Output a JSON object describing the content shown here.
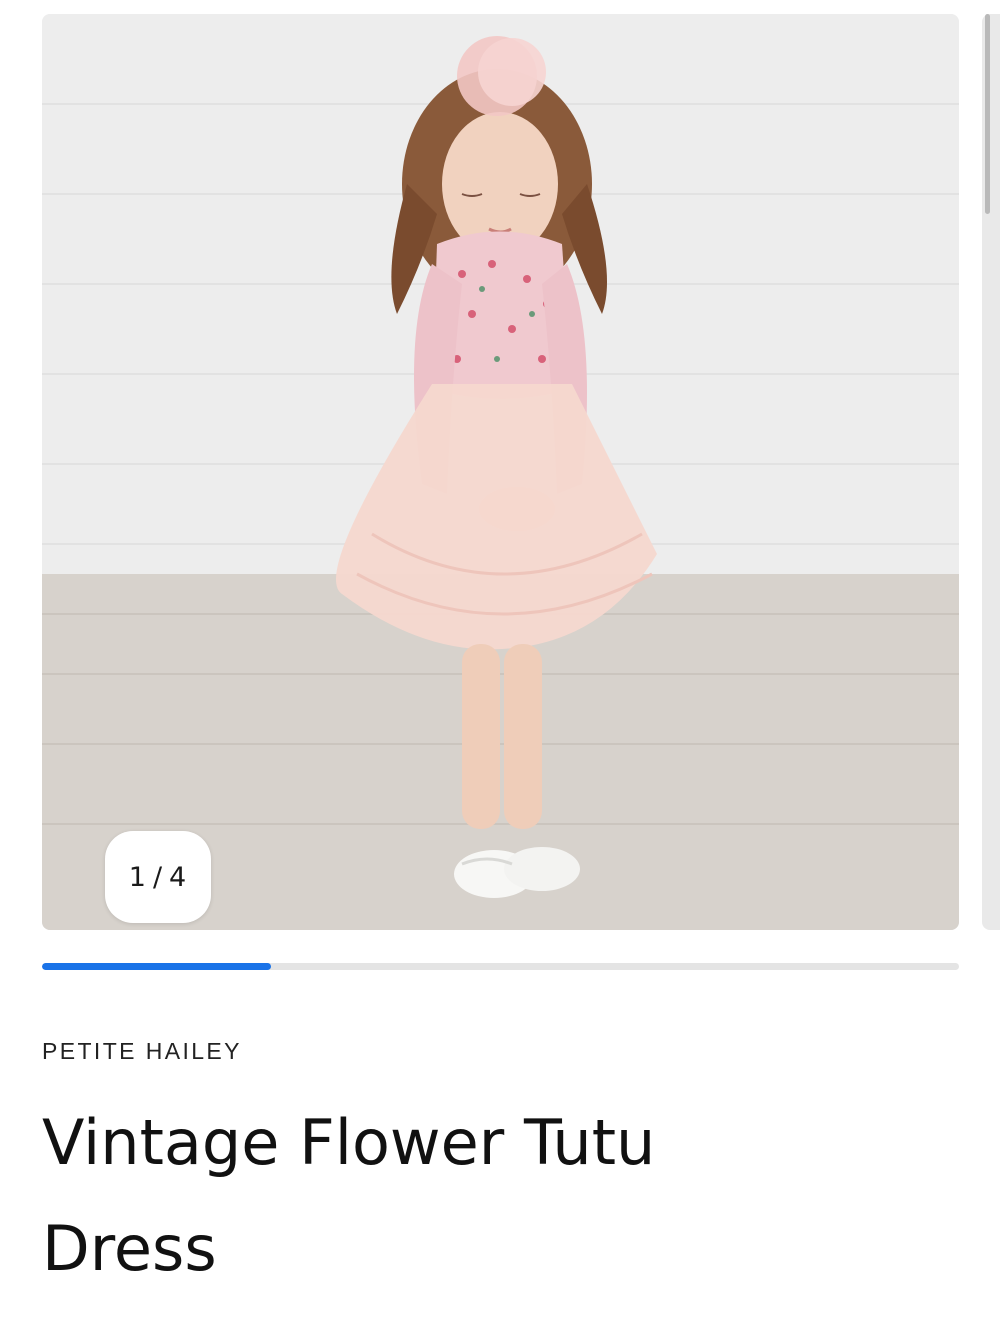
{
  "gallery": {
    "image_alt": "Girl wearing vintage flower tutu dress",
    "counter": {
      "current": "1",
      "separator": "/",
      "total": "4"
    },
    "progress_fraction": 0.25,
    "progress_color": "#1a73e8"
  },
  "product": {
    "brand": "PETITE HAILEY",
    "title": "Vintage Flower Tutu Dress"
  }
}
